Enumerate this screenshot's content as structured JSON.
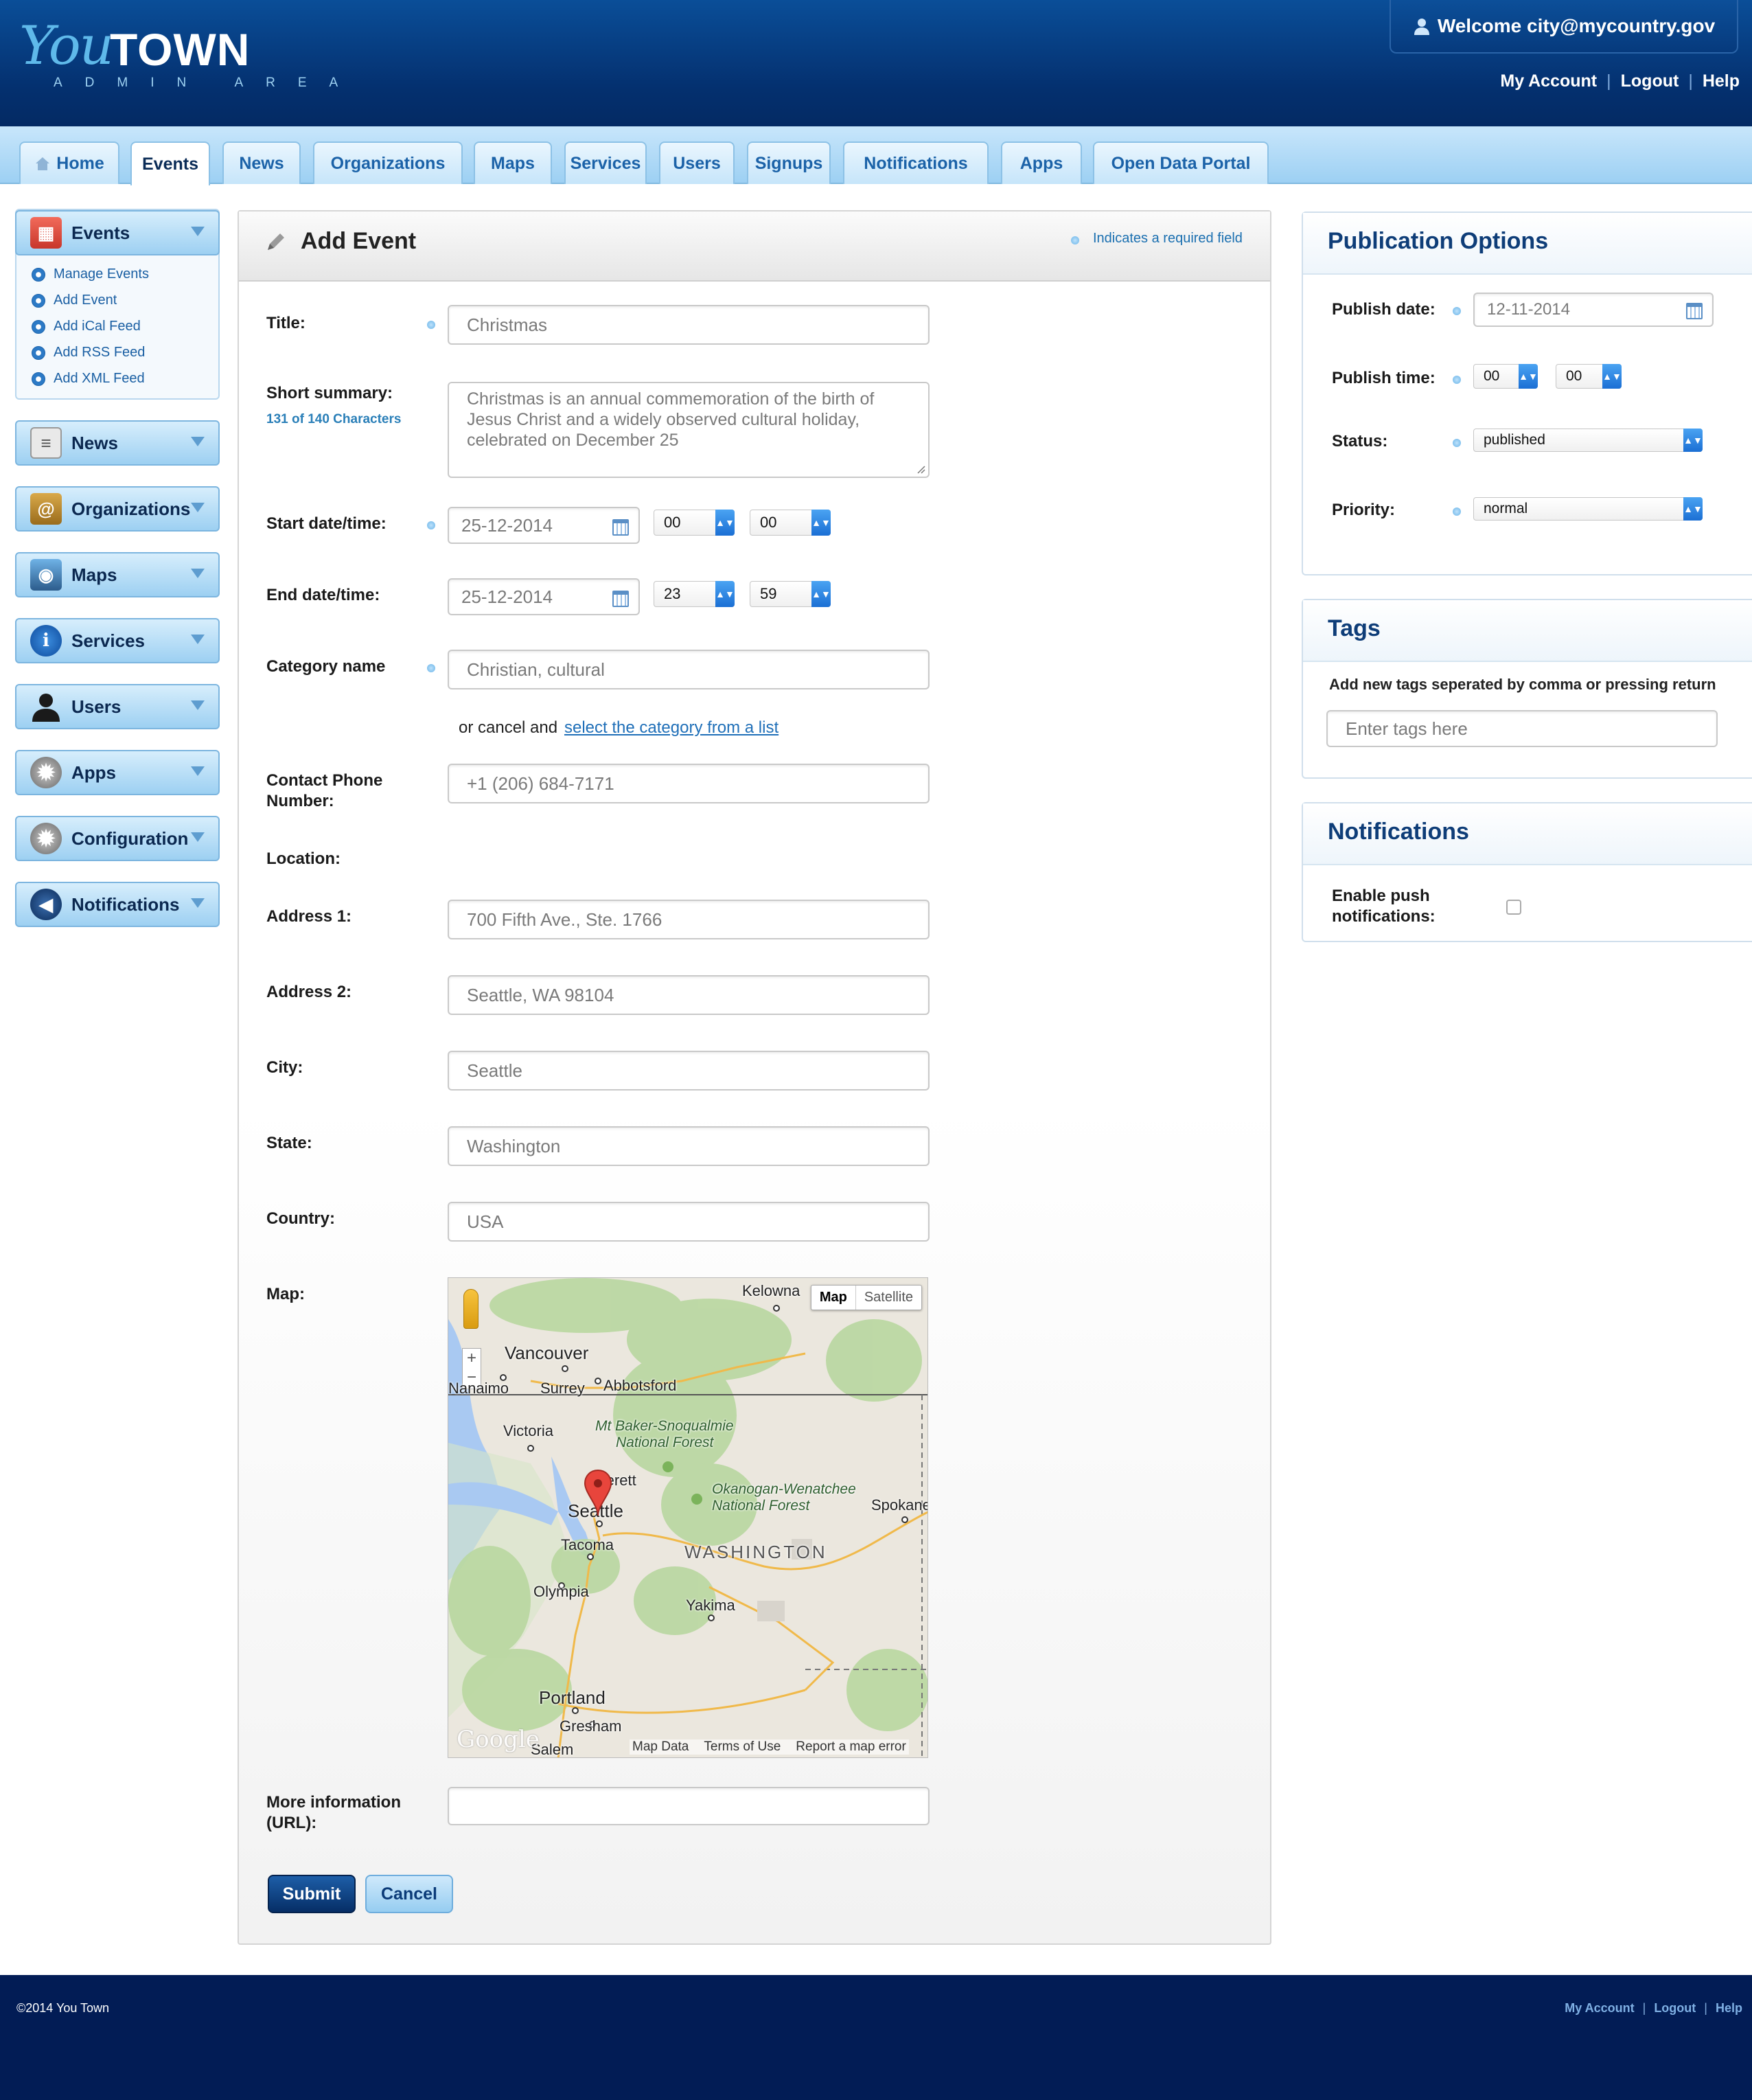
{
  "header": {
    "logo_you": "You",
    "logo_town": "TOWN",
    "logo_sub": "ADMIN AREA",
    "welcome": "Welcome city@mycountry.gov",
    "links": [
      "My Account",
      "Logout",
      "Help"
    ]
  },
  "tabs": [
    "Home",
    "Events",
    "News",
    "Organizations",
    "Maps",
    "Services",
    "Users",
    "Signups",
    "Notifications",
    "Apps",
    "Open Data Portal"
  ],
  "sidebar": {
    "events": {
      "label": "Events",
      "items": [
        "Manage Events",
        "Add Event",
        "Add iCal Feed",
        "Add RSS Feed",
        "Add XML Feed"
      ]
    },
    "sections": [
      "News",
      "Organizations",
      "Maps",
      "Services",
      "Users",
      "Apps",
      "Configuration",
      "Notifications"
    ]
  },
  "form": {
    "heading": "Add Event",
    "required_note": "Indicates a required field",
    "title_label": "Title:",
    "title_value": "Christmas",
    "summary_label": "Short summary:",
    "summary_count": "131 of 140 Characters",
    "summary_lines": [
      "Christmas is an annual commemoration of the birth of",
      "Jesus Christ and a widely observed cultural holiday,",
      "celebrated on December 25"
    ],
    "start_label": "Start date/time:",
    "start_date": "25-12-2014",
    "start_hour": "00",
    "start_min": "00",
    "end_label": "End date/time:",
    "end_date": "25-12-2014",
    "end_hour": "23",
    "end_min": "59",
    "category_label": "Category name",
    "category_value": "Christian, cultural",
    "category_cancel_text": "or cancel and",
    "category_link": "select the category from a list",
    "phone_label_1": "Contact Phone",
    "phone_label_2": "Number:",
    "phone_value": "+1 (206) 684-7171",
    "location_label": "Location:",
    "address1_label": "Address 1:",
    "address1_value": "700 Fifth Ave., Ste. 1766",
    "address2_label": "Address 2:",
    "address2_value": "Seattle, WA 98104",
    "city_label": "City:",
    "city_value": "Seattle",
    "state_label": "State:",
    "state_value": "Washington",
    "country_label": "Country:",
    "country_value": "USA",
    "map_label": "Map:",
    "url_label_1": "More information",
    "url_label_2": "(URL):",
    "url_value": "",
    "submit": "Submit",
    "cancel": "Cancel"
  },
  "map": {
    "type_map": "Map",
    "type_satellite": "Satellite",
    "zoom_in": "+",
    "zoom_out": "−",
    "labels": [
      "Kelowna",
      "Vancouver",
      "Nanaimo",
      "Surrey",
      "Abbotsford",
      "Victoria",
      "Mt Baker-Snoqualmie",
      "National Forest",
      "Everett",
      "Seattle",
      "Okanogan-Wenatchee",
      "National Forest",
      "Spokane",
      "Tacoma",
      "WASHINGTON",
      "Olympia",
      "Yakima",
      "Portland",
      "Gresham",
      "Salem"
    ],
    "footer_links": [
      "Map Data",
      "Terms of Use",
      "Report a map error"
    ],
    "logo": "Google"
  },
  "publication": {
    "title": "Publication Options",
    "publish_date_label": "Publish date:",
    "publish_date": "12-11-2014",
    "publish_time_label": "Publish time:",
    "publish_hour": "00",
    "publish_min": "00",
    "status_label": "Status:",
    "status_value": "published",
    "priority_label": "Priority:",
    "priority_value": "normal"
  },
  "tags": {
    "title": "Tags",
    "help": "Add new tags seperated by comma or pressing return",
    "placeholder": "Enter tags here"
  },
  "notifications": {
    "title": "Notifications",
    "push_label_1": "Enable push",
    "push_label_2": "notifications:",
    "push_enabled": false
  },
  "footer": {
    "copyright": "©2014 You Town",
    "links": [
      "My Account",
      "Logout",
      "Help"
    ]
  }
}
